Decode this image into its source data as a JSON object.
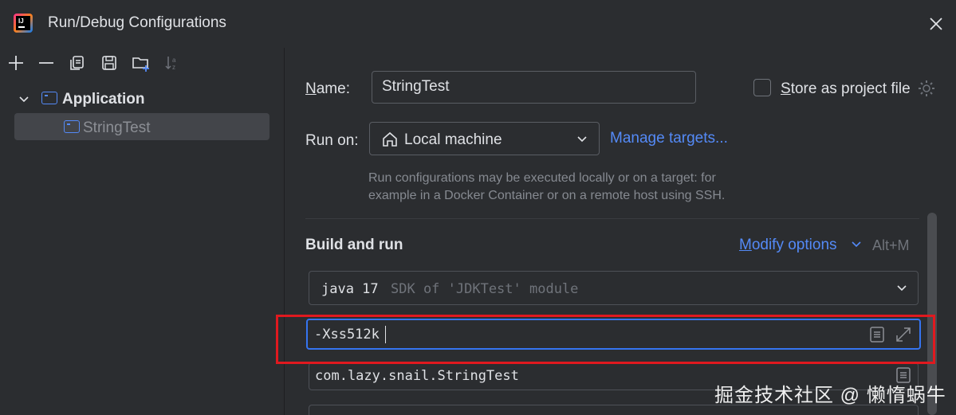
{
  "window": {
    "title": "Run/Debug Configurations",
    "logo_text": "IJ"
  },
  "tree": {
    "root_label": "Application",
    "child_label": "StringTest"
  },
  "form": {
    "name_label_u": "N",
    "name_label_rest": "ame:",
    "name_value": "StringTest",
    "store_label_u": "S",
    "store_label_rest": "tore as project file",
    "run_on_label": "Run on:",
    "run_on_value": "Local machine",
    "manage_targets": "Manage targets...",
    "hint_line1": "Run configurations may be executed locally or on a target: for",
    "hint_line2": "example in a Docker Container or on a remote host using SSH."
  },
  "build": {
    "section_title": "Build and run",
    "modify_u": "M",
    "modify_rest": "odify options",
    "shortcut": "Alt+M",
    "sdk_name": "java 17",
    "sdk_detail": "SDK of 'JDKTest' module",
    "vm_options": "-Xss512k",
    "main_class": "com.lazy.snail.StringTest"
  },
  "watermark": "掘金技术社区 @ 懒惰蜗牛",
  "colors": {
    "background": "#2b2d30",
    "accent": "#548af7",
    "focus_border": "#3574f0",
    "annotation_red": "#e0191f"
  }
}
